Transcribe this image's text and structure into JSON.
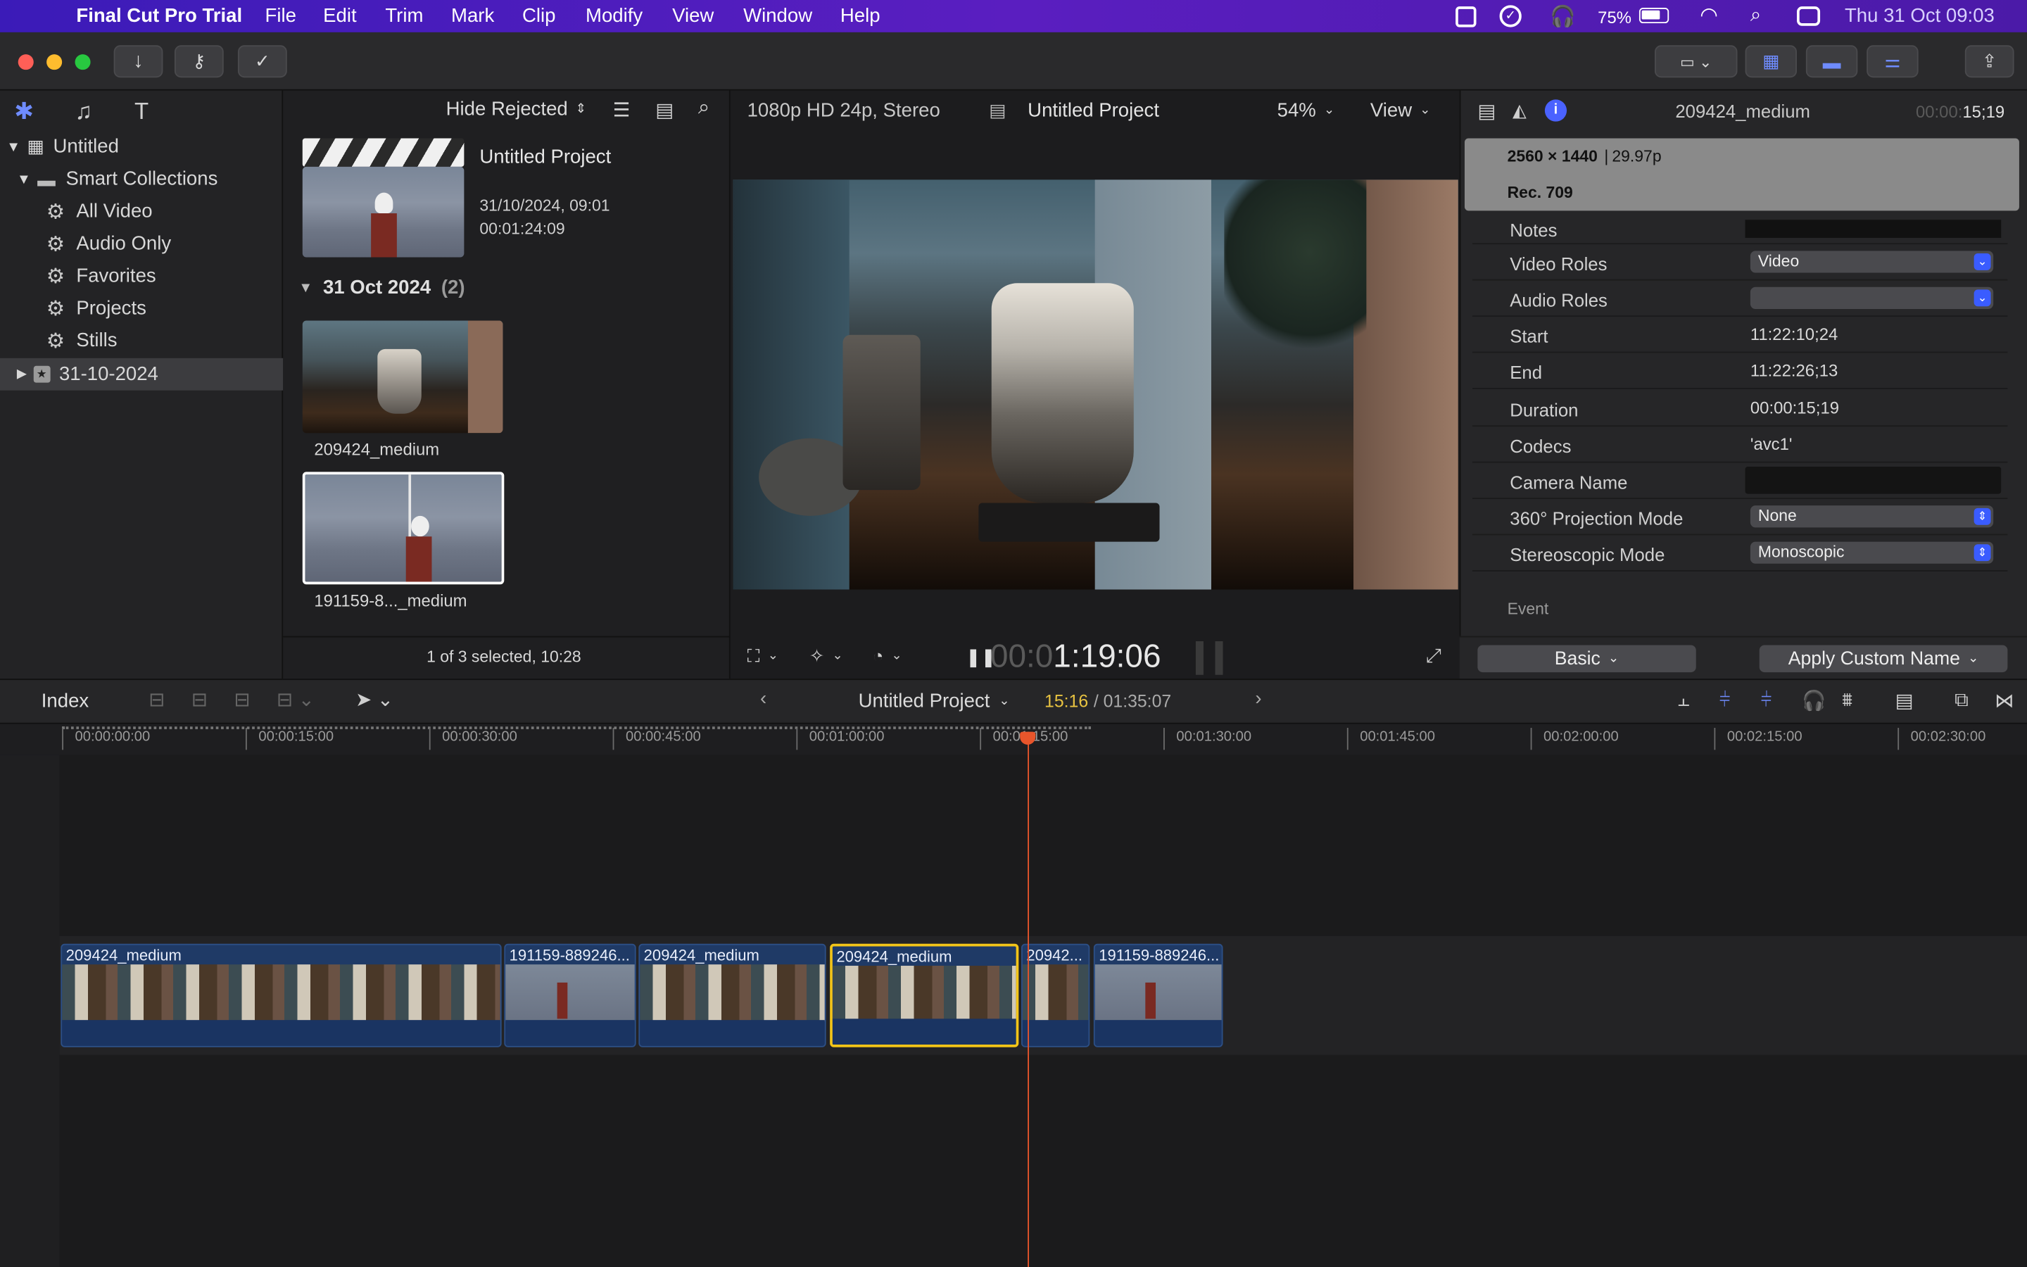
{
  "menubar": {
    "app_name": "Final Cut Pro Trial",
    "items": [
      "File",
      "Edit",
      "Trim",
      "Mark",
      "Clip",
      "Modify",
      "View",
      "Window",
      "Help"
    ],
    "battery": "75%",
    "datetime": "Thu 31 Oct  09:03"
  },
  "library": {
    "root": "Untitled",
    "smart_collections": "Smart Collections",
    "collections": [
      "All Video",
      "Audio Only",
      "Favorites",
      "Projects",
      "Stills"
    ],
    "event": "31-10-2024"
  },
  "browser": {
    "filter": "Hide Rejected",
    "project": {
      "name": "Untitled Project",
      "date": "31/10/2024, 09:01",
      "duration": "00:01:24:09"
    },
    "group_label": "31 Oct 2024",
    "group_count": "(2)",
    "clips": [
      "209424_medium",
      "191159-8..._medium"
    ],
    "status": "1 of 3 selected, 10:28"
  },
  "viewer": {
    "format": "1080p HD 24p, Stereo",
    "project_name": "Untitled Project",
    "zoom": "54%",
    "view_menu": "View",
    "timecode_dim": "00:0",
    "timecode": "1:19:06"
  },
  "inspector": {
    "clip_name": "209424_medium",
    "duration_dim": "00:00:",
    "duration": "15;19",
    "resolution": "2560 × 1440",
    "frame_rate": "29.97p",
    "color_space": "Rec. 709",
    "notes_label": "Notes",
    "rows": [
      {
        "label": "Video Roles",
        "value": "Video",
        "type": "select"
      },
      {
        "label": "Audio Roles",
        "value": "",
        "type": "select"
      },
      {
        "label": "Start",
        "value": "11:22:10;24",
        "type": "text"
      },
      {
        "label": "End",
        "value": "11:22:26;13",
        "type": "text"
      },
      {
        "label": "Duration",
        "value": "00:00:15;19",
        "type": "text"
      },
      {
        "label": "Codecs",
        "value": "'avc1'",
        "type": "text"
      },
      {
        "label": "Camera Name",
        "value": "",
        "type": "field"
      },
      {
        "label": "360° Projection Mode",
        "value": "None",
        "type": "stepper"
      },
      {
        "label": "Stereoscopic Mode",
        "value": "Monoscopic",
        "type": "stepper"
      }
    ],
    "event_label": "Event",
    "metadata_view": "Basic",
    "apply_button": "Apply Custom Name"
  },
  "timeline": {
    "index": "Index",
    "project": "Untitled Project",
    "position": "15:16",
    "total": "/ 01:35:07",
    "ticks": [
      "00:00:00:00",
      "00:00:15:00",
      "00:00:30:00",
      "00:00:45:00",
      "00:01:00:00",
      "00:01:15:00",
      "00:01:30:00",
      "00:01:45:00",
      "00:02:00:00",
      "00:02:15:00",
      "00:02:30:00"
    ],
    "clips": [
      {
        "name": "209424_medium",
        "kind": "coffee"
      },
      {
        "name": "191159-889246...",
        "kind": "seagull"
      },
      {
        "name": "209424_medium",
        "kind": "coffee"
      },
      {
        "name": "209424_medium",
        "kind": "coffee",
        "selected": true
      },
      {
        "name": "20942...",
        "kind": "coffee"
      },
      {
        "name": "191159-889246...",
        "kind": "seagull"
      }
    ]
  },
  "colors": {
    "accent": "#3a5cff",
    "playhead": "#e8552b",
    "selection": "#f2c418",
    "clip_blue": "#1f3a66",
    "menubar": "#4a1cb8"
  }
}
